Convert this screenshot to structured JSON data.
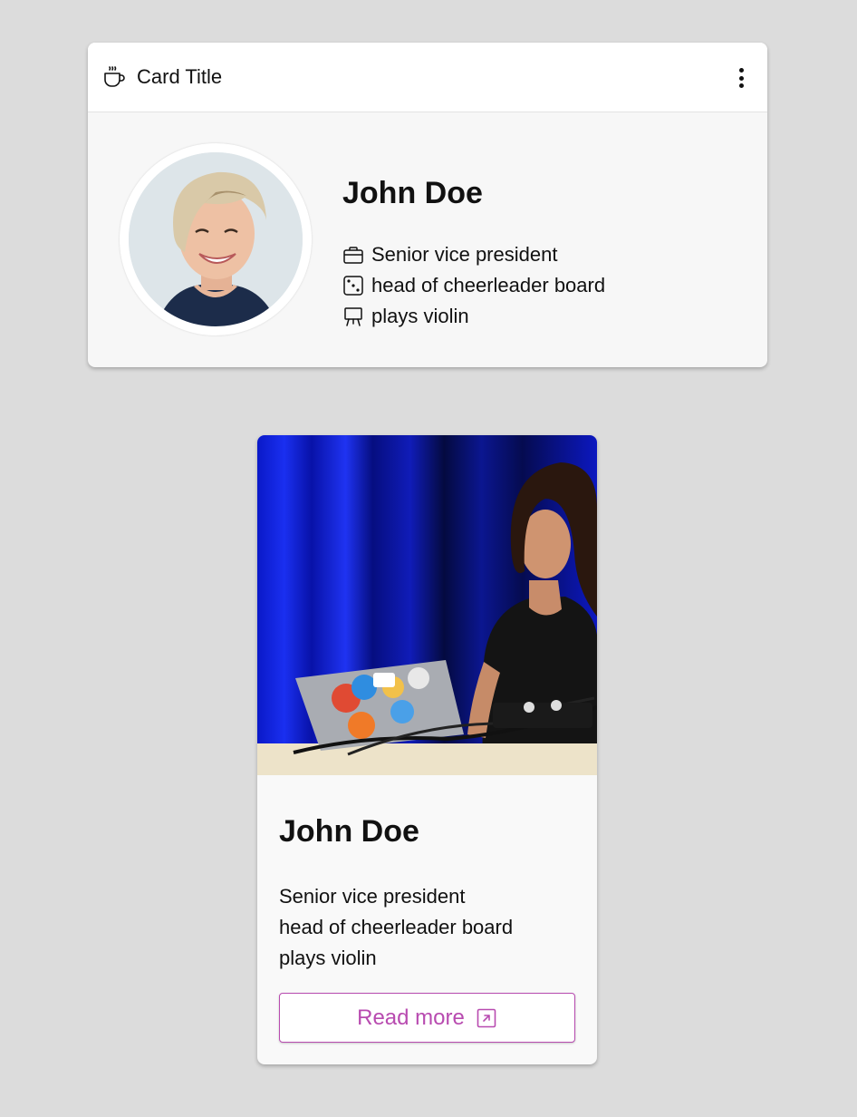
{
  "profile_card": {
    "title": "Card Title",
    "title_icon": "coffee-cup-icon",
    "menu_icon": "kebab-menu-icon",
    "name": "John Doe",
    "facts": [
      {
        "icon": "briefcase-icon",
        "text": "Senior vice president"
      },
      {
        "icon": "dice-icon",
        "text": "head of cheerleader board"
      },
      {
        "icon": "easel-icon",
        "text": "plays violin"
      }
    ]
  },
  "photo_card": {
    "name": "John Doe",
    "lines": [
      "Senior vice president",
      "head of cheerleader board",
      "plays violin"
    ],
    "button_label": "Read more",
    "button_icon": "external-link-icon"
  },
  "colors": {
    "background": "#dcdcdc",
    "card": "#f7f7f7",
    "accent": "#b84bb0",
    "photo_curtain": "#0a1fd8"
  }
}
